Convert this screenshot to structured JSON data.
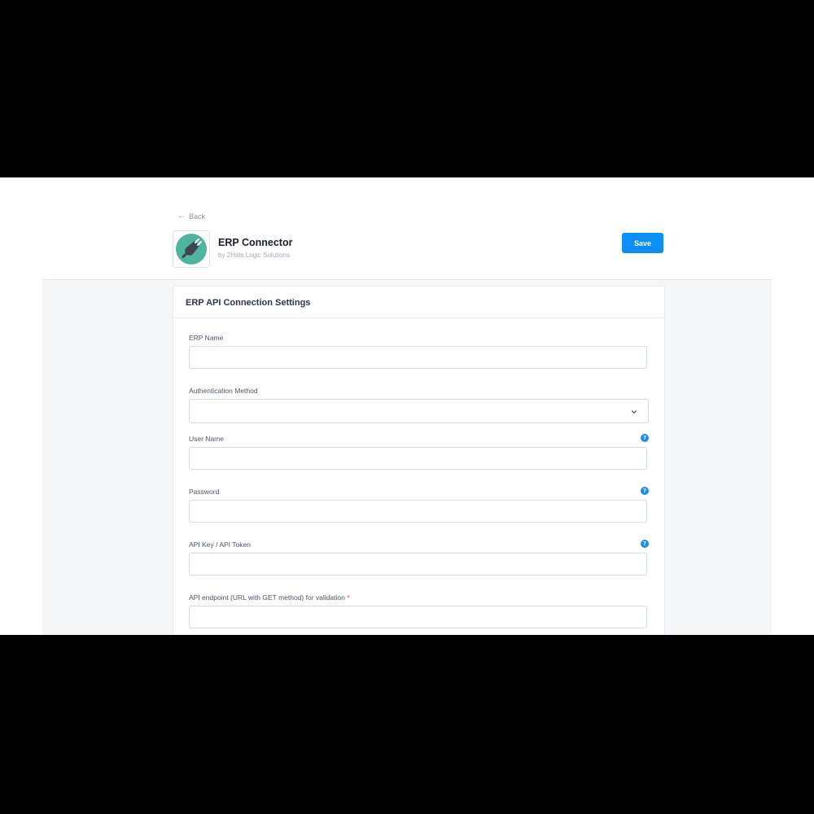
{
  "header": {
    "back_label": "Back",
    "app_title": "ERP Connector",
    "app_vendor": "by 2Hats Logic Solutions",
    "app_icon": "plug-icon",
    "save_label": "Save"
  },
  "card": {
    "title": "ERP API Connection Settings"
  },
  "fields": [
    {
      "label": "ERP Name",
      "value": "",
      "type": "text"
    },
    {
      "label": "Authentication Method",
      "value": "",
      "type": "select"
    },
    {
      "label": "User Name",
      "value": "",
      "type": "text",
      "help_icon": "question-icon"
    },
    {
      "label": "Password",
      "value": "",
      "type": "password",
      "help_icon": "question-icon"
    },
    {
      "label": "API Key / API Token",
      "value": "",
      "type": "text",
      "help_icon": "question-icon"
    },
    {
      "label": "API endpoint (URL with GET method) for validation",
      "required_mark": "*",
      "value": "",
      "type": "text"
    }
  ],
  "colors": {
    "accent": "#0d8ef2",
    "logo_bg": "#4fb59f",
    "help": "#1a8cf0"
  }
}
